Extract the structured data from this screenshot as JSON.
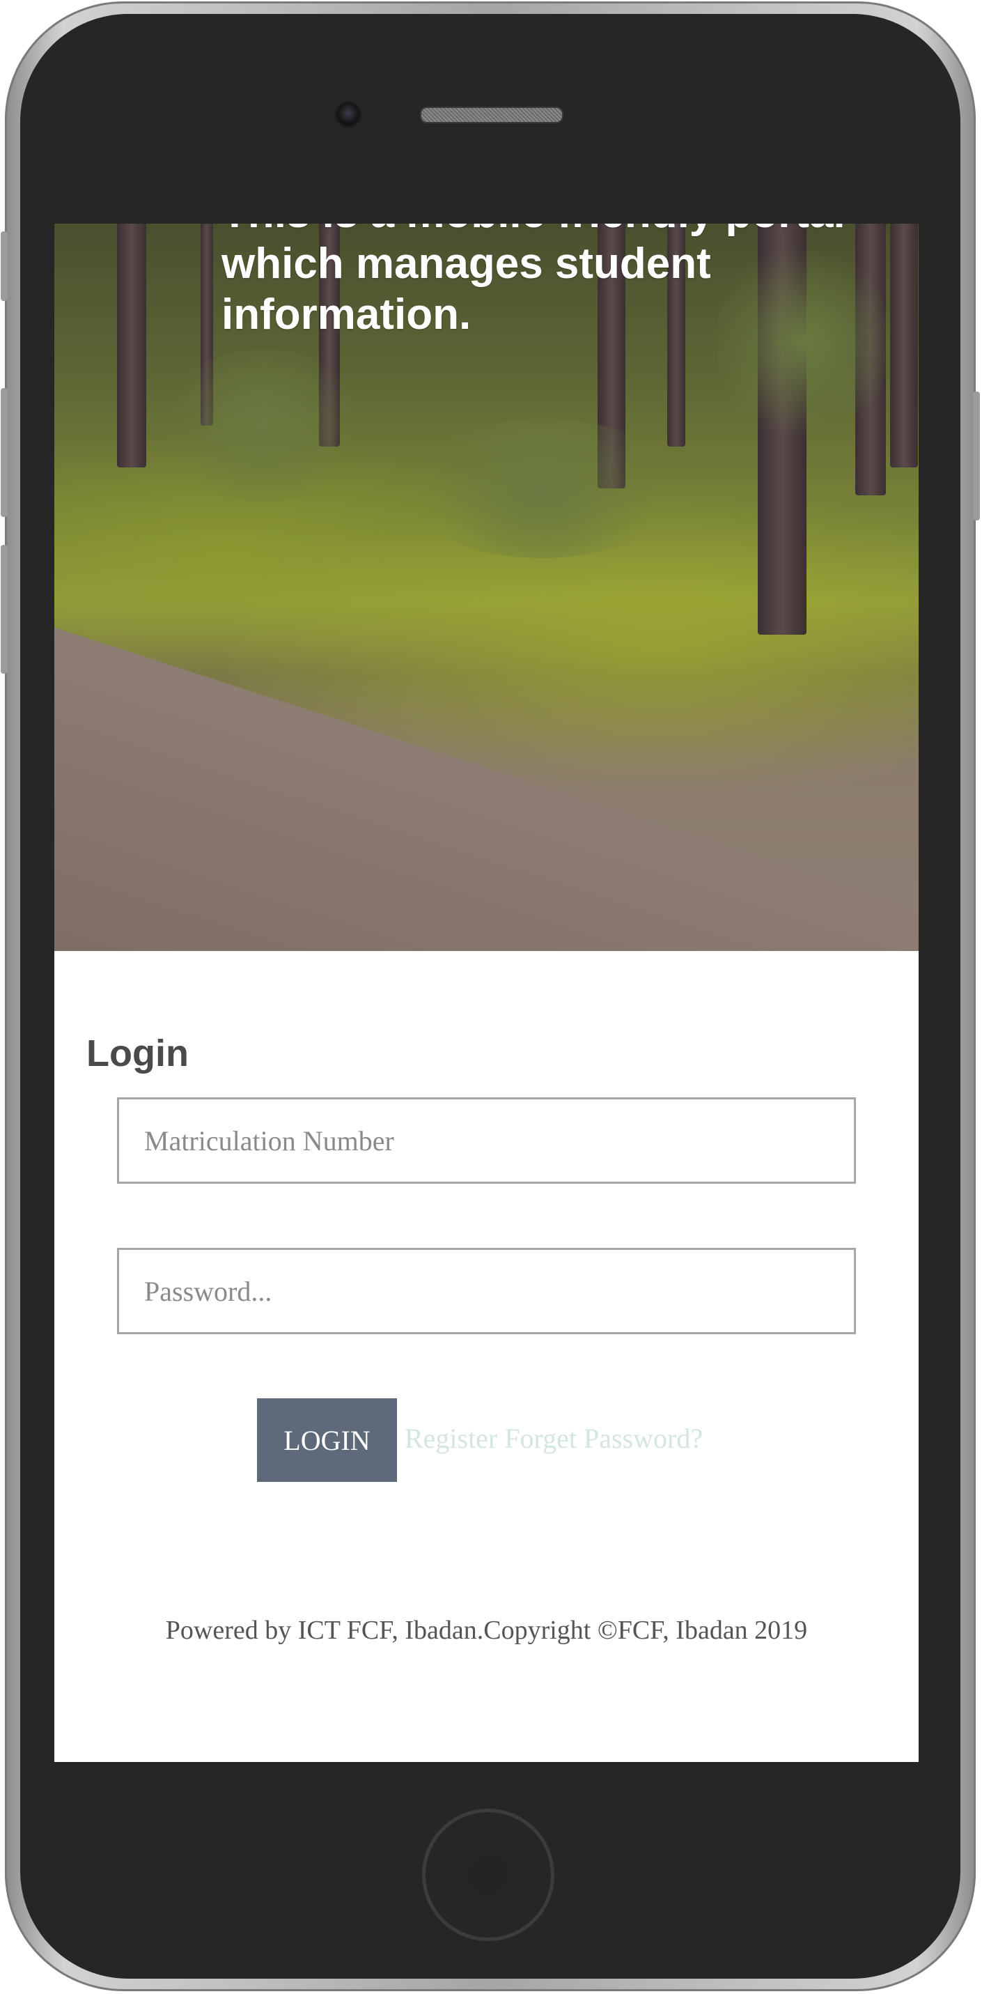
{
  "hero": {
    "text": "This is a mobile friendly portal which manages student information."
  },
  "login": {
    "title": "Login",
    "matric_placeholder": "Matriculation Number",
    "password_placeholder": "Password...",
    "button_label": "LOGIN",
    "register_label": "Register",
    "forget_label": "Forget Password?"
  },
  "footer": {
    "text": "Powered by ICT FCF, Ibadan.Copyright ©FCF, Ibadan 2019"
  },
  "colors": {
    "button_bg": "#5e6a7a",
    "link": "#d4e6e2",
    "phone_body": "#262626"
  }
}
